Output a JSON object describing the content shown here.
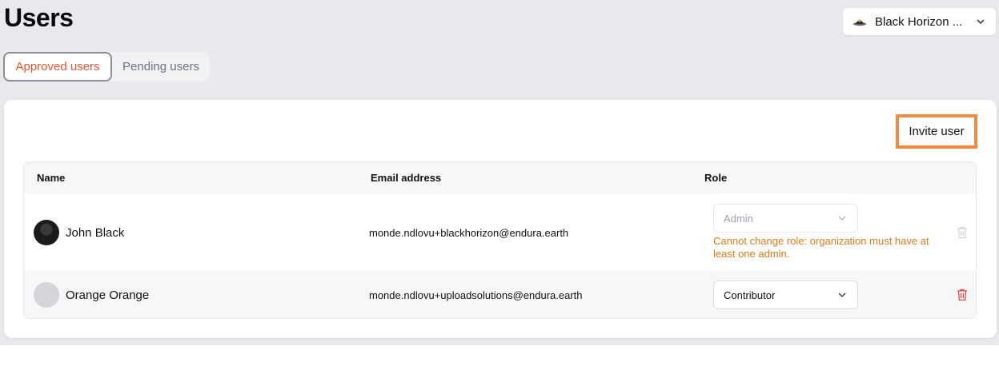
{
  "page": {
    "title": "Users"
  },
  "org_selector": {
    "name": "Black Horizon ...",
    "logo_icon": "org-logo-icon",
    "chevron_icon": "chevron-down-icon"
  },
  "tabs": [
    {
      "label": "Approved users",
      "active": true
    },
    {
      "label": "Pending users",
      "active": false
    }
  ],
  "actions": {
    "invite_label": "Invite user"
  },
  "table": {
    "headers": {
      "name": "Name",
      "email": "Email address",
      "role": "Role"
    },
    "rows": [
      {
        "name": "John Black",
        "email": "monde.ndlovu+blackhorizon@endura.earth",
        "role": "Admin",
        "role_disabled": true,
        "hint": "Cannot change role: organization must have at least one admin.",
        "avatar": "photo",
        "delete_disabled": true
      },
      {
        "name": "Orange Orange",
        "email": "monde.ndlovu+uploadsolutions@endura.earth",
        "role": "Contributor",
        "role_disabled": false,
        "hint": "",
        "avatar": "placeholder",
        "delete_disabled": false
      }
    ]
  },
  "colors": {
    "accent": "#e4572e",
    "warning": "#e07b1a",
    "danger": "#e5484d",
    "highlight": "#f48a3c"
  }
}
